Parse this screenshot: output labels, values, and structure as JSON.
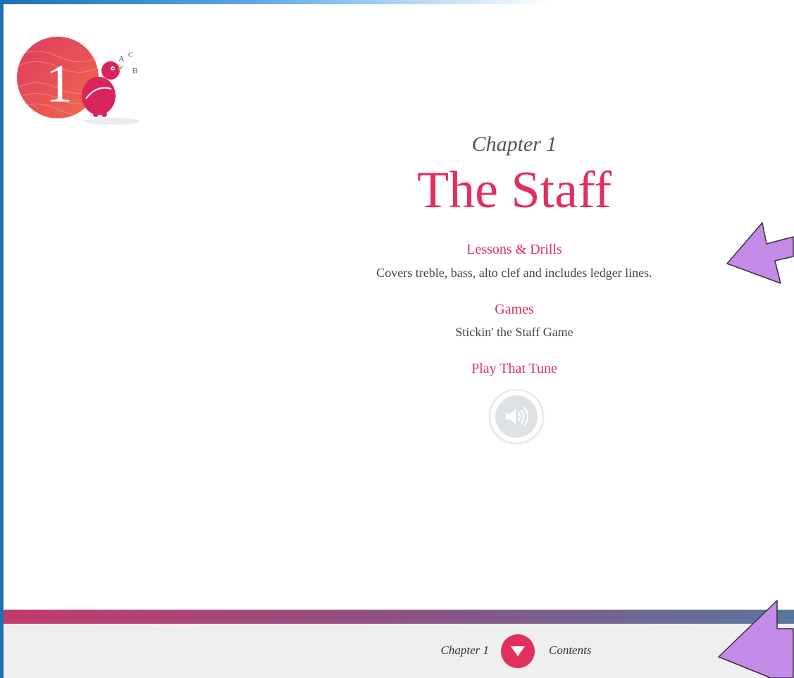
{
  "header": {
    "chapter_label": "Chapter 1",
    "chapter_title": "The Staff",
    "logo_number": "1",
    "logo_letters": [
      "A",
      "C",
      "B"
    ]
  },
  "sections": [
    {
      "title": "Lessons & Drills",
      "description": "Covers treble, bass, alto clef and includes ledger lines."
    },
    {
      "title": "Games",
      "description": "Stickin' the Staff Game"
    },
    {
      "title": "Play That Tune",
      "description": ""
    }
  ],
  "audio": {
    "icon": "speaker-icon"
  },
  "footer": {
    "chapter": "Chapter 1",
    "contents": "Contents",
    "contents_icon": "triangle-down-icon"
  },
  "colors": {
    "accent": "#e0305e",
    "footer_bg": "#efefef",
    "annotation_arrow": "#c48ae8",
    "frame_blue": "#1d6fb8"
  }
}
